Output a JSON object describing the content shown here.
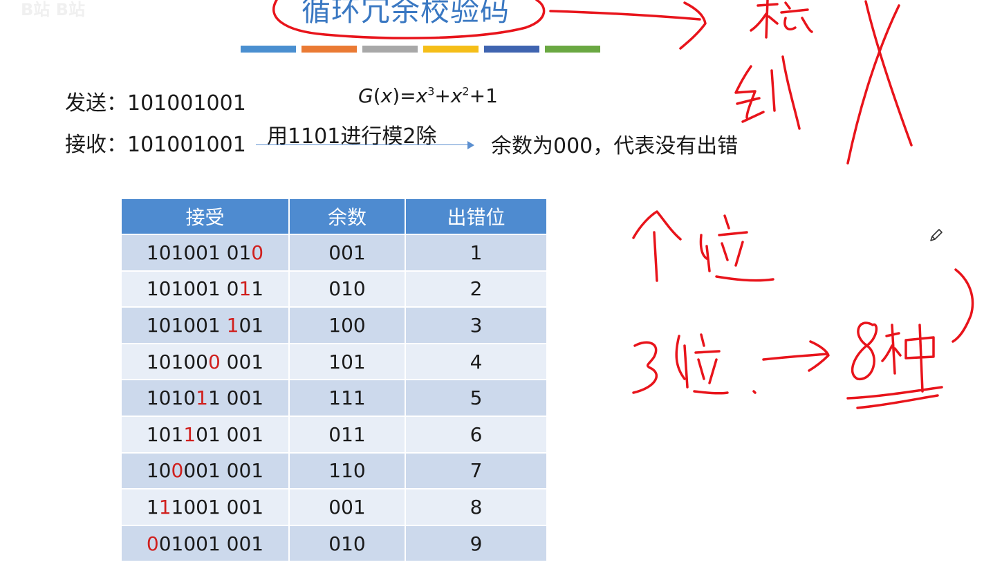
{
  "watermark": "B站 B站",
  "title": "循环冗余校验码",
  "color_bar": [
    "#4a8fd0",
    "#ea7a34",
    "#a8a8a8",
    "#f5be18",
    "#3f64b0",
    "#6aa842"
  ],
  "send": {
    "label": "发送：",
    "value": "101001001"
  },
  "formula": {
    "g": "G",
    "x": "x",
    "eq": ")=",
    "t1": "x",
    "e1": "3",
    "plus1": "+",
    "t2": "x",
    "e2": "2",
    "rest": "+1",
    "open": "("
  },
  "receive": {
    "label": "接收：",
    "value": "101001001"
  },
  "arrow_label": "用1101进行模2除",
  "result": "余数为000，代表没有出错",
  "table": {
    "headers": [
      "接受",
      "余数",
      "出错位"
    ],
    "rows": [
      {
        "pre": "101001 01",
        "err": "0",
        "post": "",
        "rem": "001",
        "pos": "1"
      },
      {
        "pre": "101001 0",
        "err": "1",
        "post": "1",
        "rem": "010",
        "pos": "2"
      },
      {
        "pre": "101001 ",
        "err": "1",
        "post": "01",
        "rem": "100",
        "pos": "3"
      },
      {
        "pre": "10100",
        "err": "0",
        "post": " 001",
        "rem": "101",
        "pos": "4"
      },
      {
        "pre": "1010",
        "err": "1",
        "post": "1 001",
        "rem": "111",
        "pos": "5"
      },
      {
        "pre": "101",
        "err": "1",
        "post": "01 001",
        "rem": "011",
        "pos": "6"
      },
      {
        "pre": "10",
        "err": "0",
        "post": "001 001",
        "rem": "110",
        "pos": "7"
      },
      {
        "pre": "1",
        "err": "1",
        "post": "1001 001",
        "rem": "001",
        "pos": "8"
      },
      {
        "pre": "",
        "err": "0",
        "post": "01001 001",
        "rem": "010",
        "pos": "9"
      }
    ]
  },
  "icons": {
    "pencil": "pencil-icon"
  }
}
